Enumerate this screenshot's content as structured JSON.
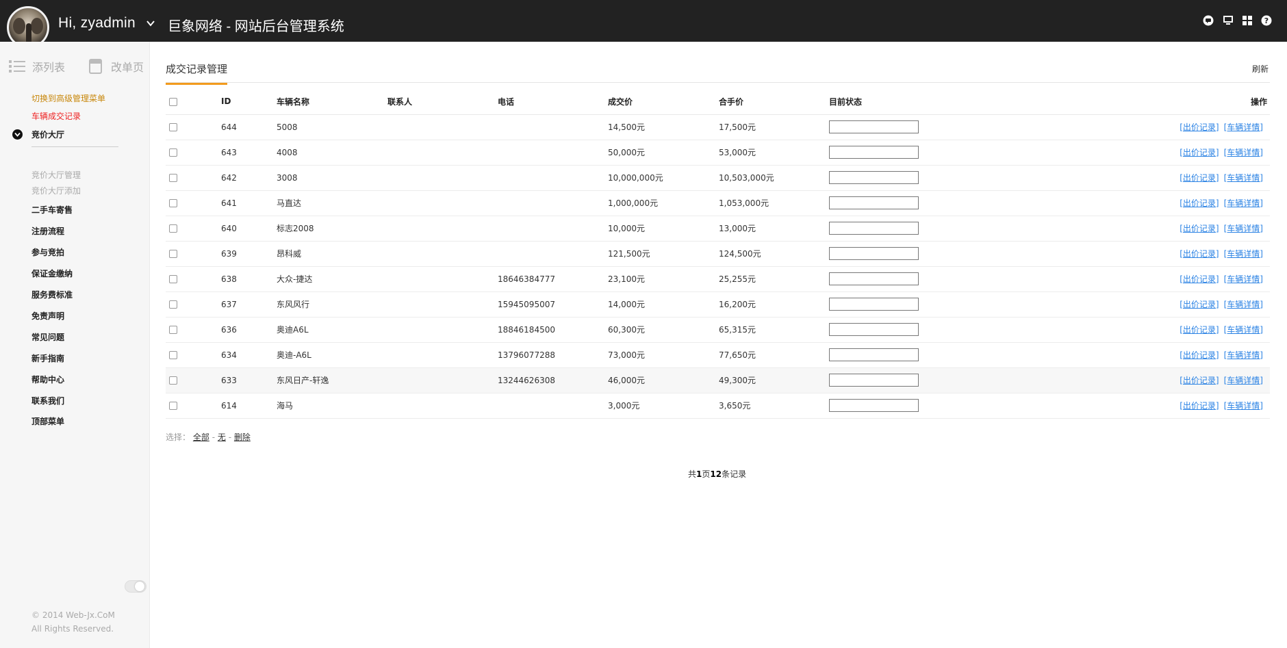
{
  "header": {
    "greeting": "Hi, zyadmin",
    "site_title": "巨象网络 - 网站后台管理系统",
    "icons": [
      "chat-icon",
      "monitor-icon",
      "grid-icon",
      "help-icon"
    ]
  },
  "sidebar": {
    "tab_list": "添列表",
    "tab_page": "改单页",
    "link_advanced": "切换到高级管理菜单",
    "link_records": "车辆成交记录",
    "group": "竞价大厅",
    "sub_items": [
      "竞价大厅管理",
      "竞价大厅添加"
    ],
    "items": [
      "二手车寄售",
      "注册流程",
      "参与竞拍",
      "保证金缴纳",
      "服务费标准",
      "免责声明",
      "常见问题",
      "新手指南",
      "帮助中心",
      "联系我们",
      "顶部菜单"
    ],
    "footer_copyright": "© 2014 Web-Jx.CoM",
    "footer_rights": "All Rights Reserved."
  },
  "main": {
    "tab_title": "成交记录管理",
    "refresh": "刷新",
    "columns": [
      "ID",
      "车辆名称",
      "联系人",
      "电话",
      "成交价",
      "合手价",
      "目前状态",
      "操作"
    ],
    "rows": [
      {
        "id": "644",
        "name": "5008",
        "contact": "",
        "phone": "",
        "deal": "14,500元",
        "total": "17,500元"
      },
      {
        "id": "643",
        "name": "4008",
        "contact": "",
        "phone": "",
        "deal": "50,000元",
        "total": "53,000元"
      },
      {
        "id": "642",
        "name": "3008",
        "contact": "",
        "phone": "",
        "deal": "10,000,000元",
        "total": "10,503,000元"
      },
      {
        "id": "641",
        "name": "马直达",
        "contact": "",
        "phone": "",
        "deal": "1,000,000元",
        "total": "1,053,000元"
      },
      {
        "id": "640",
        "name": "标志2008",
        "contact": "",
        "phone": "",
        "deal": "10,000元",
        "total": "13,000元"
      },
      {
        "id": "639",
        "name": "昂科威",
        "contact": "",
        "phone": "",
        "deal": "121,500元",
        "total": "124,500元"
      },
      {
        "id": "638",
        "name": "大众-捷达",
        "contact": "",
        "phone": "18646384777",
        "deal": "23,100元",
        "total": "25,255元"
      },
      {
        "id": "637",
        "name": "东风风行",
        "contact": "",
        "phone": "15945095007",
        "deal": "14,000元",
        "total": "16,200元"
      },
      {
        "id": "636",
        "name": "奥迪A6L",
        "contact": "",
        "phone": "18846184500",
        "deal": "60,300元",
        "total": "65,315元"
      },
      {
        "id": "634",
        "name": "奥迪-A6L",
        "contact": "",
        "phone": "13796077288",
        "deal": "73,000元",
        "total": "77,650元"
      },
      {
        "id": "633",
        "name": "东风日产-轩逸",
        "contact": "",
        "phone": "13244626308",
        "deal": "46,000元",
        "total": "49,300元"
      },
      {
        "id": "614",
        "name": "海马",
        "contact": "",
        "phone": "",
        "deal": "3,000元",
        "total": "3,650元"
      }
    ],
    "op_bid_records": "[出价记录]",
    "op_car_detail": "[车辆详情]",
    "select_label": "选择：",
    "select_all": "全部",
    "select_none": "无",
    "select_delete": "删除",
    "separator": "-",
    "pager_prefix": "共",
    "pager_pages": "1",
    "pager_mid": "页",
    "pager_count": "12",
    "pager_suffix": "条记录"
  },
  "colors": {
    "header_bg": "#222222",
    "accent_orange": "#f29b1d",
    "price_red": "#e3131b",
    "link_blue": "#2a82e4",
    "sidebar_gold": "#c8870b"
  }
}
